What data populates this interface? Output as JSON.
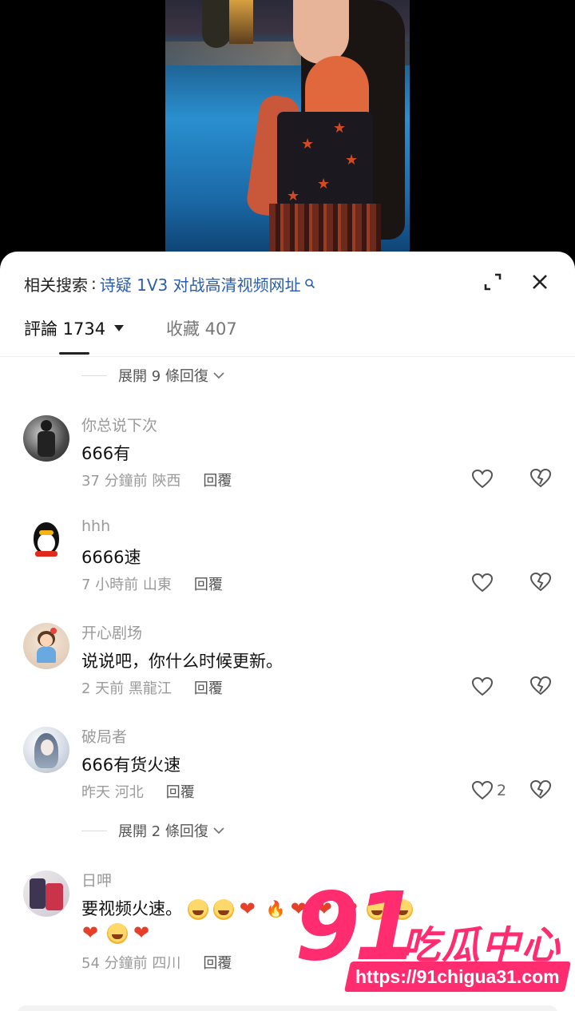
{
  "search": {
    "prefix": "相关搜索",
    "separator": ":",
    "query": "诗疑 1V3 对战高清视频网址"
  },
  "tabs": {
    "comments_label": "評論 1734",
    "favorites_label": "收藏 407"
  },
  "expanders": [
    {
      "label": "展開 9 條回復"
    },
    {
      "label": "展開 2 條回復"
    }
  ],
  "comments": [
    {
      "user": "你总说下次",
      "text": "666有",
      "time": "37 分鐘前",
      "location": "陝西",
      "reply": "回覆",
      "likes": ""
    },
    {
      "user": "hhh",
      "text": "6666速",
      "time": "7 小時前",
      "location": "山東",
      "reply": "回覆",
      "likes": ""
    },
    {
      "user": "开心剧场",
      "text": "说说吧，你什么时候更新。",
      "time": "2 天前",
      "location": "黑龍江",
      "reply": "回覆",
      "likes": ""
    },
    {
      "user": "破局者",
      "text": "666有货火速",
      "time": "昨天",
      "location": "河北",
      "reply": "回覆",
      "likes": "2"
    },
    {
      "user": "日呷",
      "text": "要视频火速。",
      "time": "54 分鐘前",
      "location": "四川",
      "reply": "回覆",
      "likes": ""
    }
  ],
  "emoji_line": [
    "laugh",
    "laugh",
    "heart",
    "fire",
    "heart",
    "heart",
    "heart",
    "laugh",
    "laugh"
  ],
  "emoji_line2": [
    "heart",
    "laugh",
    "heart"
  ],
  "watermark": {
    "logo": "91",
    "name": "吃瓜中心",
    "url": "https://91chigua31.com"
  },
  "colors": {
    "link": "#2d5da8",
    "watermark": "#ff2d6f"
  }
}
